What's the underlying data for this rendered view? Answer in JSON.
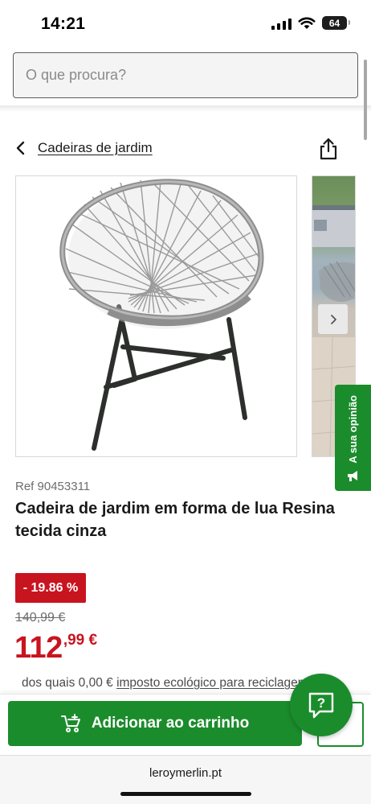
{
  "status_bar": {
    "time": "14:21",
    "battery": "64",
    "icons": [
      "signal-icon",
      "wifi-icon",
      "battery-icon"
    ]
  },
  "search": {
    "placeholder": "O que procura?"
  },
  "breadcrumb": {
    "label": "Cadeiras de jardim",
    "back_icon": "chevron-left-icon",
    "share_icon": "share-icon"
  },
  "gallery": {
    "main_image": "grey moon-shaped woven garden chair",
    "next_image": "chair on terrace",
    "next_icon": "chevron-right-icon"
  },
  "feedback": {
    "label": "A sua opinião",
    "icon": "megaphone-icon"
  },
  "product": {
    "ref": "Ref 90453311",
    "title": "Cadeira de jardim em forma de lua Resina tecida cinza",
    "discount": "- 19.86 %",
    "old_price": "140,99 €",
    "price_int": "112",
    "price_dec": ",99 €",
    "eco_prefix": "dos quais 0,00 € ",
    "eco_link": "imposto ecológico para reciclagem de"
  },
  "help": {
    "icon": "question-chat-icon",
    "label": "?"
  },
  "actions": {
    "add_to_cart": "Adicionar ao carrinho",
    "cart_icon": "cart-add-icon",
    "secondary_icon": "pencil-icon"
  },
  "browser": {
    "url": "leroymerlin.pt"
  },
  "colors": {
    "brand_green": "#1b8c2c",
    "promo_red": "#c8141f"
  }
}
